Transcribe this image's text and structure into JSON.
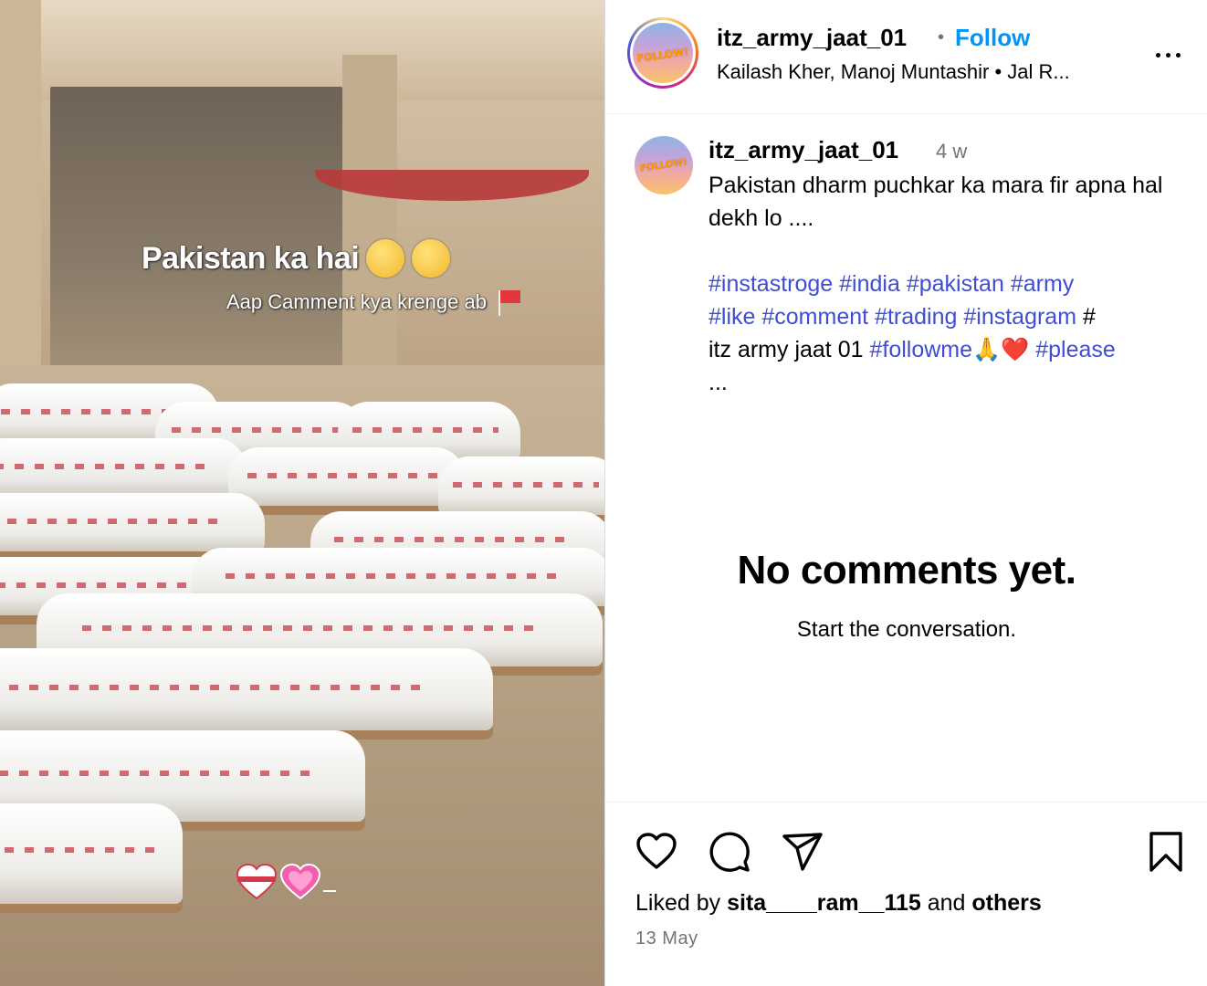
{
  "media": {
    "overlay_title": "Pakistan ka hai",
    "overlay_emojis": [
      "raised-eyebrow-face",
      "shushing-face"
    ],
    "overlay_subtitle": "Aap Camment kya krenge ab",
    "overlay_flag_icon": "red-flag-icon",
    "bottom_emojis": [
      "ribbon-heart-icon",
      "growing-heart-icon"
    ],
    "bottom_dash": "_"
  },
  "header": {
    "username": "itz_army_jaat_01",
    "separator": "•",
    "follow_label": "Follow",
    "audio_info": "Kailash Kher, Manoj Muntashir • Jal R...",
    "avatar_text": "FOLLOW!",
    "more_icon": "more-options-icon"
  },
  "caption": {
    "username": "itz_army_jaat_01",
    "time": "4 w",
    "text": "Pakistan dharm puchkar ka mara fir apna hal dekh lo ....",
    "tags_line1": [
      " #instastroge",
      "#india",
      "#pakistan",
      "#army"
    ],
    "tags_line2": [
      "#like",
      "#comment",
      "#trading",
      "#instagram"
    ],
    "tags_line2_tail": " #",
    "line3_plain": "itz army jaat 01",
    "line3_tags": [
      "#followme🙏❤️",
      "#please"
    ],
    "ellipsis": "..."
  },
  "comments": {
    "empty_title": "No comments yet.",
    "empty_subtitle": "Start the conversation."
  },
  "actions": {
    "liked_prefix": "Liked by",
    "liked_user": "sita____ram__115",
    "liked_middle": "and",
    "liked_others": "others",
    "date": "13 May",
    "icons": [
      "heart-icon",
      "comment-icon",
      "share-icon",
      "save-icon"
    ]
  },
  "colors": {
    "link": "#0095f6",
    "hashtag": "#3f4dd3",
    "muted": "#737373"
  }
}
